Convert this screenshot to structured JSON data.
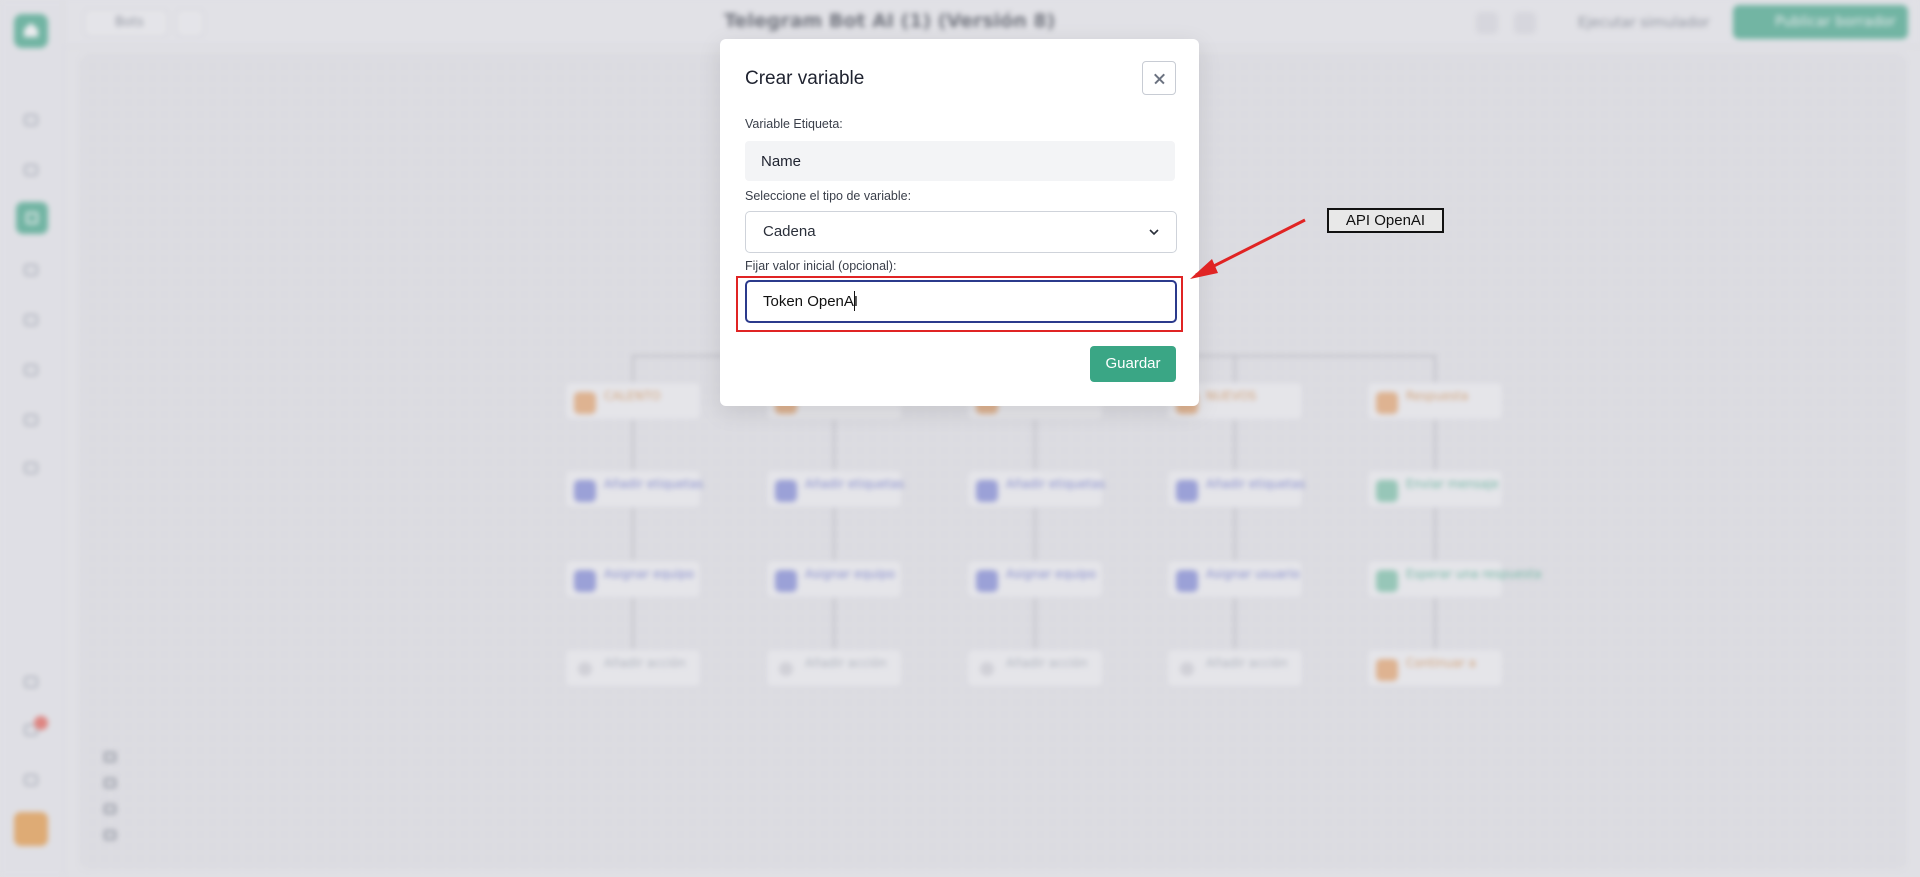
{
  "app": {
    "title": "Telegram Bot AI (1) (Versión 8)",
    "back_label": "Bots",
    "simulator_label": "Ejecutar simulador",
    "publish_label": "Publicar borrador",
    "accent_color": "#3aa685",
    "nodes": [
      [
        "CALENTO",
        "Añadir etiquetas",
        "Asignar equipo",
        "Añadir acción"
      ],
      [
        "",
        "Añadir etiquetas",
        "Asignar equipo",
        "Añadir acción"
      ],
      [
        "",
        "Añadir etiquetas",
        "Asignar equipo",
        "Añadir acción"
      ],
      [
        "NUEVOS",
        "Añadir etiquetas",
        "Asignar usuario",
        "Añadir acción"
      ],
      [
        "Respuesta",
        "Enviar mensaje",
        "Esperar una respuesta",
        "Continuar a"
      ]
    ]
  },
  "modal": {
    "title": "Crear variable",
    "label_field_label": "Variable Etiqueta:",
    "label_value": "Name",
    "type_label": "Seleccione el tipo de variable:",
    "type_value": "Cadena",
    "initial_label": "Fijar valor inicial (opcional):",
    "initial_value": "Token OpenAI",
    "save_label": "Guardar"
  },
  "annotation": {
    "callout_text": "API OpenAI",
    "highlight_color": "#e02424"
  }
}
